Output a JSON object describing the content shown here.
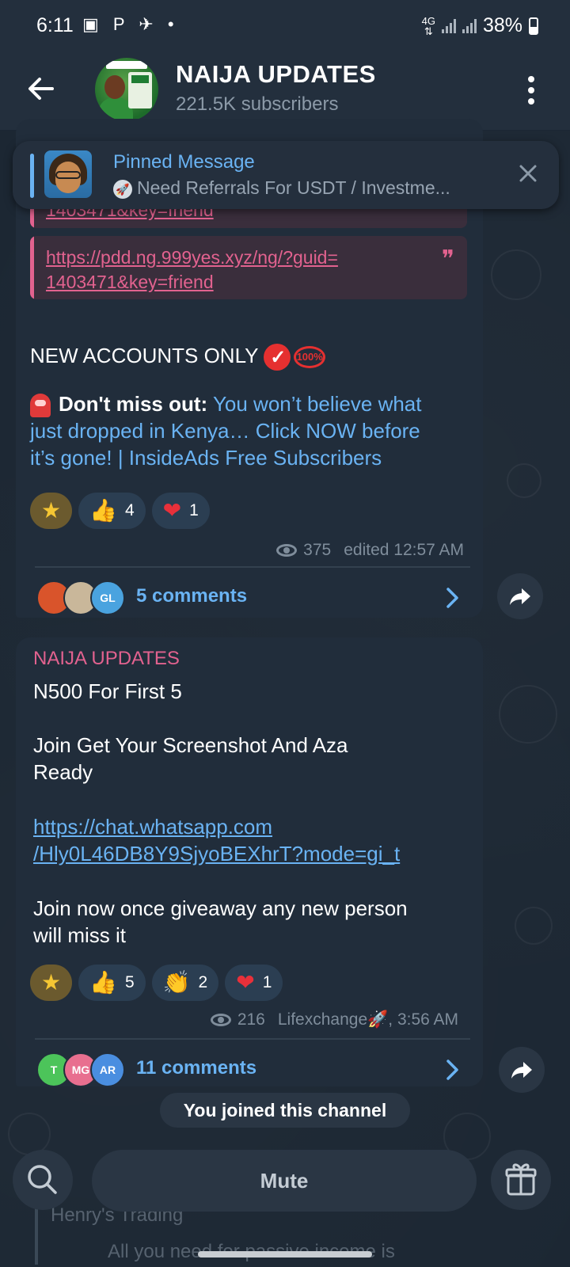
{
  "status": {
    "time": "6:11",
    "left_icons": "▣ P ✈ •",
    "network": "4G",
    "battery": "38%"
  },
  "header": {
    "title": "NAIJA UPDATES",
    "subscribers": "221.5K subscribers"
  },
  "pinned": {
    "title": "Pinned Message",
    "text": "Need Referrals For USDT / Investme..."
  },
  "post1": {
    "quote_partial": "1403471&key=friend",
    "quote_link": "https://pdd.ng.999yes.xyz/ng/?guid=\n1403471&key=friend",
    "quote_line1": "https://pdd.ng.999yes.xyz/ng/?guid=",
    "quote_line2": "1403471&key=friend",
    "accounts": "NEW ACCOUNTS ONLY",
    "badge_100": "100%",
    "dont_miss": "Don't miss out:",
    "ad_line1": "You won’t believe what",
    "ad_line2": "just dropped in Kenya… Click NOW before",
    "ad_line3": "it’s gone! | InsideAds Free Subscribers",
    "reactions": [
      {
        "emoji": "star",
        "count": ""
      },
      {
        "emoji": "thumbs-up",
        "count": "4"
      },
      {
        "emoji": "heart",
        "count": "1"
      }
    ],
    "views": "375",
    "edited": "edited 12:57 AM",
    "comments": "5 comments",
    "commenter_initials": [
      "",
      "",
      "GL"
    ]
  },
  "post2": {
    "sender": "NAIJA UPDATES",
    "line1": "N500 For First 5",
    "line2": "Join Get Your Screenshot And Aza",
    "line3": "Ready",
    "link1": "https://chat.whatsapp.com",
    "link2": "/Hly0L46DB8Y9SjyoBEXhrT?mode=gi_t",
    "line4": "Join now once giveaway any new person",
    "line5": "will miss it",
    "reactions": [
      {
        "emoji": "star",
        "count": ""
      },
      {
        "emoji": "thumbs-up",
        "count": "5"
      },
      {
        "emoji": "clap",
        "count": "2"
      },
      {
        "emoji": "heart",
        "count": "1"
      }
    ],
    "views": "216",
    "author_time": "Lifexchange🚀, 3:56 AM",
    "comments": "11 comments",
    "commenter_initials": [
      "T",
      "MG",
      "AR"
    ]
  },
  "joined": "You joined this channel",
  "preview": {
    "title": "Henry's Trading",
    "text": "All you need for passive income is"
  },
  "bottom": {
    "mute": "Mute"
  },
  "colors": {
    "accent": "#6ab3f3",
    "quote": "#e2628f",
    "bubble": "#212d3b",
    "header": "#232f3d"
  }
}
